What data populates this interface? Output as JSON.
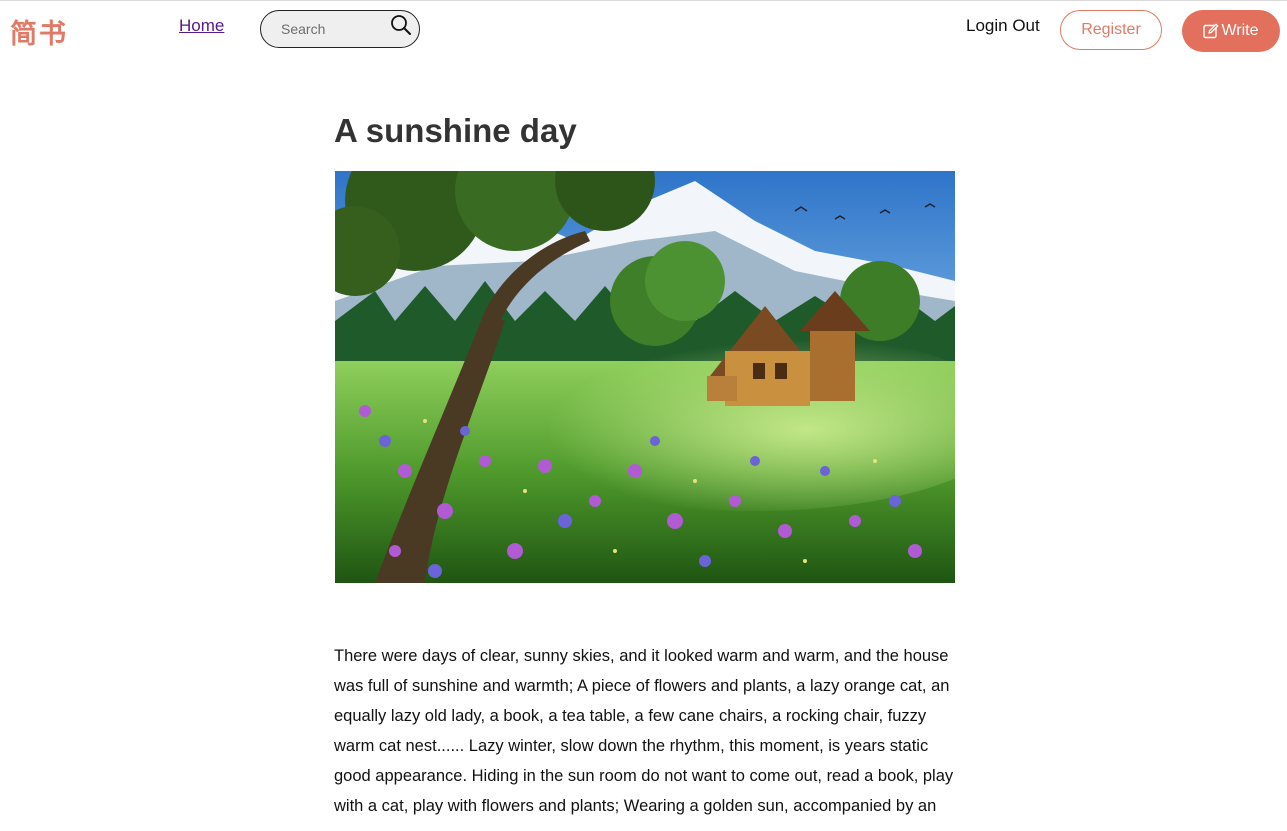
{
  "header": {
    "logo": "简书",
    "nav_home": "Home",
    "search_placeholder": "Search",
    "login_out": "Login Out",
    "register": "Register",
    "write": "Write"
  },
  "article": {
    "title": "A sunshine day",
    "image_alt": "Illustration of a wooden cabin in a flower meadow below snowy mountains",
    "body": "There were days of clear, sunny skies, and it looked warm and warm, and the house was full of sunshine and warmth; A piece of flowers and plants, a lazy orange cat, an equally lazy old lady, a book, a tea table, a few cane chairs, a rocking chair, fuzzy warm cat nest...... Lazy winter, slow down the rhythm, this moment, is years static good appearance. Hiding in the sun room do not want to come out, read a book, play with a cat, play with flowers and plants; Wearing a golden sun, accompanied by an"
  },
  "colors": {
    "brand": "#e07a66",
    "write_bg": "#e2705c",
    "link_visited": "#551a8b"
  },
  "icons": {
    "search": "search-icon",
    "write": "edit-icon"
  }
}
